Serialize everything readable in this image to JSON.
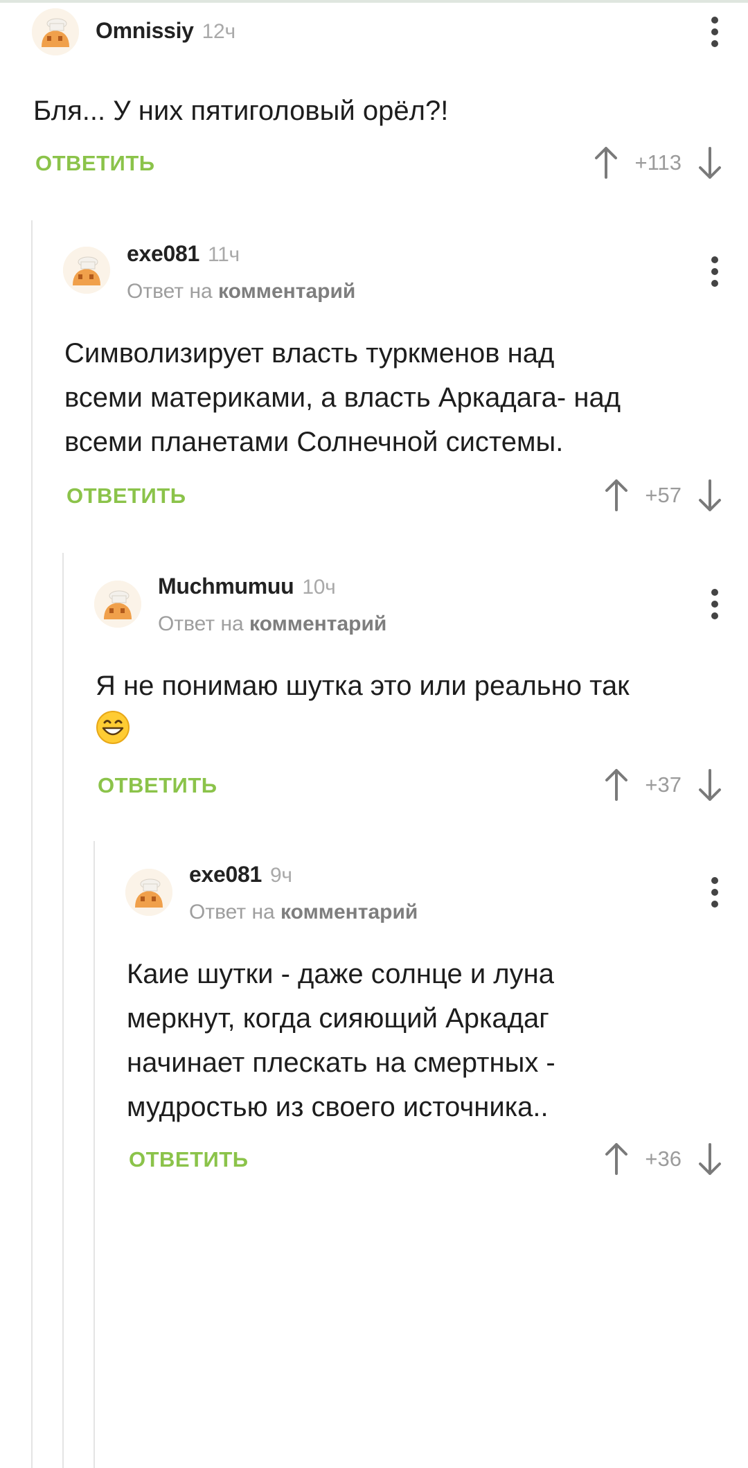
{
  "reply_label": "ОТВЕТИТЬ",
  "reply_to_prefix": "Ответ на",
  "reply_to_link": "комментарий",
  "colors": {
    "accent_green": "#8bc34a",
    "meta_gray": "#a9a9a9",
    "thread_line": "#e4e4e4"
  },
  "comments": [
    {
      "author": "Omnissiy",
      "time": "12ч",
      "text_lines": [
        "Бля... У них пятиголовый орёл?!"
      ],
      "score": "+113"
    },
    {
      "author": "exe081",
      "time": "11ч",
      "text_lines": [
        "Символизирует власть туркменов над",
        "всеми материками, а власть Аркадага- над",
        "всеми планетами Солнечной системы."
      ],
      "score": "+57"
    },
    {
      "author": "Muchmumuu",
      "time": "10ч",
      "text_lines": [
        "Я не понимаю шутка это или реально так"
      ],
      "emoji": "grinning-face-emoji",
      "score": "+37"
    },
    {
      "author": "exe081",
      "time": "9ч",
      "text_lines": [
        "Каие шутки - даже солнце и луна",
        "меркнут,  когда сияющий Аркадаг",
        "начинает плескать на смертных -",
        "мудростью из своего источника.."
      ],
      "score": "+36"
    }
  ]
}
